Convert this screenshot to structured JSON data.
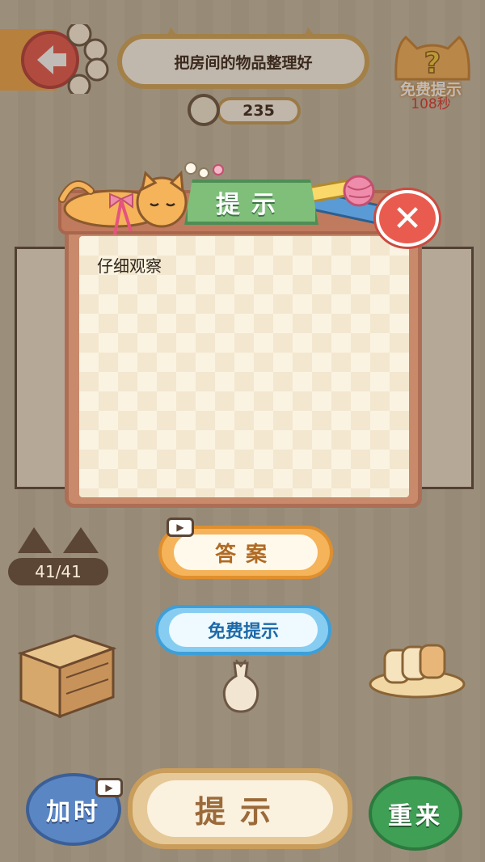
{
  "header": {
    "task": "把房间的物品整理好",
    "timer": "235",
    "free_hint_label": "免费提示",
    "free_hint_cooldown": "108秒"
  },
  "hint_dialog": {
    "title": "提示",
    "message": "仔细观察"
  },
  "progress": "41/41",
  "buttons": {
    "answer": "答案",
    "free_hint": "免费提示",
    "add_time": "加时",
    "hint": "提示",
    "restart": "重来"
  },
  "colors": {
    "background": "#c9bea9",
    "dialog_frame": "#c98a6c",
    "tab_green": "#7fbf7a",
    "close_red": "#ea5b4f",
    "answer_orange": "#f5b35a",
    "free_blue": "#87cdf2"
  }
}
